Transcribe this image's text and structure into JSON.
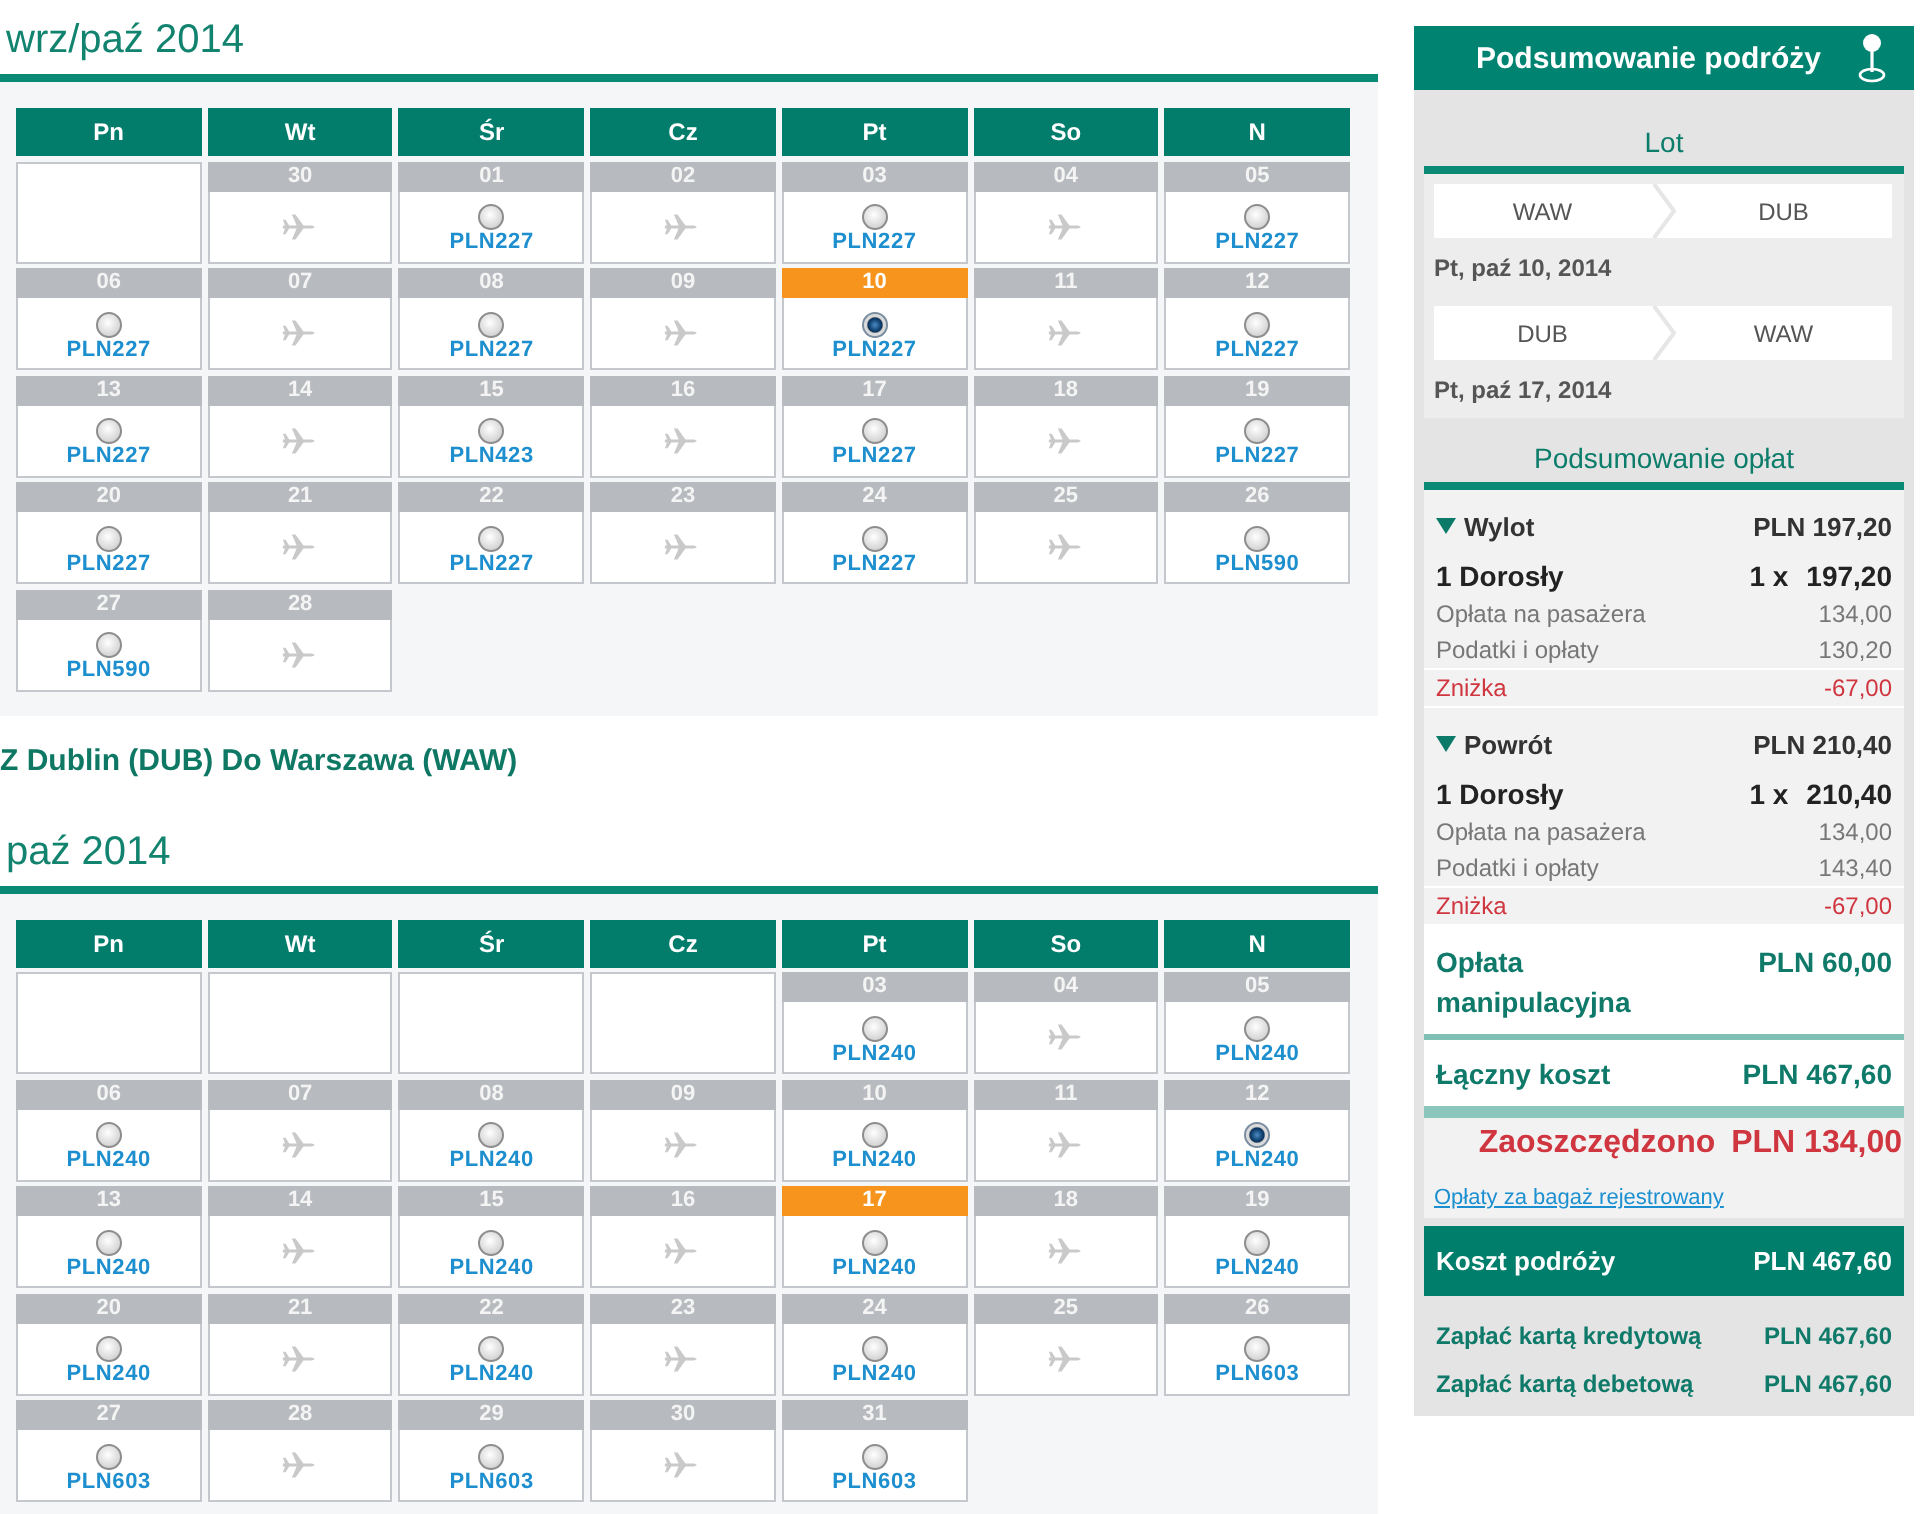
{
  "outbound": {
    "title": "wrz/paź 2014",
    "weekdays": [
      "Pn",
      "Wt",
      "Śr",
      "Cz",
      "Pt",
      "So",
      "N"
    ],
    "weeks": [
      [
        {
          "kind": "empty"
        },
        {
          "kind": "unavailable",
          "day": "30",
          "highlighted": false
        },
        {
          "kind": "fare",
          "day": "01",
          "highlighted": false,
          "selected": false,
          "price": "PLN227"
        },
        {
          "kind": "unavailable",
          "day": "02",
          "highlighted": false
        },
        {
          "kind": "fare",
          "day": "03",
          "highlighted": false,
          "selected": false,
          "price": "PLN227"
        },
        {
          "kind": "unavailable",
          "day": "04",
          "highlighted": false
        },
        {
          "kind": "fare",
          "day": "05",
          "highlighted": false,
          "selected": false,
          "price": "PLN227"
        }
      ],
      [
        {
          "kind": "fare",
          "day": "06",
          "highlighted": false,
          "selected": false,
          "price": "PLN227"
        },
        {
          "kind": "unavailable",
          "day": "07",
          "highlighted": false
        },
        {
          "kind": "fare",
          "day": "08",
          "highlighted": false,
          "selected": false,
          "price": "PLN227"
        },
        {
          "kind": "unavailable",
          "day": "09",
          "highlighted": false
        },
        {
          "kind": "fare",
          "day": "10",
          "highlighted": true,
          "selected": true,
          "price": "PLN227"
        },
        {
          "kind": "unavailable",
          "day": "11",
          "highlighted": false
        },
        {
          "kind": "fare",
          "day": "12",
          "highlighted": false,
          "selected": false,
          "price": "PLN227"
        }
      ],
      [
        {
          "kind": "fare",
          "day": "13",
          "highlighted": false,
          "selected": false,
          "price": "PLN227"
        },
        {
          "kind": "unavailable",
          "day": "14",
          "highlighted": false
        },
        {
          "kind": "fare",
          "day": "15",
          "highlighted": false,
          "selected": false,
          "price": "PLN423"
        },
        {
          "kind": "unavailable",
          "day": "16",
          "highlighted": false
        },
        {
          "kind": "fare",
          "day": "17",
          "highlighted": false,
          "selected": false,
          "price": "PLN227"
        },
        {
          "kind": "unavailable",
          "day": "18",
          "highlighted": false
        },
        {
          "kind": "fare",
          "day": "19",
          "highlighted": false,
          "selected": false,
          "price": "PLN227"
        }
      ],
      [
        {
          "kind": "fare",
          "day": "20",
          "highlighted": false,
          "selected": false,
          "price": "PLN227"
        },
        {
          "kind": "unavailable",
          "day": "21",
          "highlighted": false
        },
        {
          "kind": "fare",
          "day": "22",
          "highlighted": false,
          "selected": false,
          "price": "PLN227"
        },
        {
          "kind": "unavailable",
          "day": "23",
          "highlighted": false
        },
        {
          "kind": "fare",
          "day": "24",
          "highlighted": false,
          "selected": false,
          "price": "PLN227"
        },
        {
          "kind": "unavailable",
          "day": "25",
          "highlighted": false
        },
        {
          "kind": "fare",
          "day": "26",
          "highlighted": false,
          "selected": false,
          "price": "PLN590"
        }
      ],
      [
        {
          "kind": "fare",
          "day": "27",
          "highlighted": false,
          "selected": false,
          "price": "PLN590"
        },
        {
          "kind": "unavailable",
          "day": "28",
          "highlighted": false
        }
      ]
    ]
  },
  "return_route": "Z Dublin (DUB) Do Warszawa (WAW)",
  "return": {
    "title": "paź 2014",
    "weekdays": [
      "Pn",
      "Wt",
      "Śr",
      "Cz",
      "Pt",
      "So",
      "N"
    ],
    "weeks": [
      [
        {
          "kind": "empty"
        },
        {
          "kind": "empty"
        },
        {
          "kind": "empty"
        },
        {
          "kind": "empty"
        },
        {
          "kind": "fare",
          "day": "03",
          "highlighted": false,
          "selected": false,
          "price": "PLN240"
        },
        {
          "kind": "unavailable",
          "day": "04",
          "highlighted": false
        },
        {
          "kind": "fare",
          "day": "05",
          "highlighted": false,
          "selected": false,
          "price": "PLN240"
        }
      ],
      [
        {
          "kind": "fare",
          "day": "06",
          "highlighted": false,
          "selected": false,
          "price": "PLN240"
        },
        {
          "kind": "unavailable",
          "day": "07",
          "highlighted": false
        },
        {
          "kind": "fare",
          "day": "08",
          "highlighted": false,
          "selected": false,
          "price": "PLN240"
        },
        {
          "kind": "unavailable",
          "day": "09",
          "highlighted": false
        },
        {
          "kind": "fare",
          "day": "10",
          "highlighted": false,
          "selected": false,
          "price": "PLN240"
        },
        {
          "kind": "unavailable",
          "day": "11",
          "highlighted": false
        },
        {
          "kind": "fare",
          "day": "12",
          "highlighted": false,
          "selected": true,
          "price": "PLN240"
        }
      ],
      [
        {
          "kind": "fare",
          "day": "13",
          "highlighted": false,
          "selected": false,
          "price": "PLN240"
        },
        {
          "kind": "unavailable",
          "day": "14",
          "highlighted": false
        },
        {
          "kind": "fare",
          "day": "15",
          "highlighted": false,
          "selected": false,
          "price": "PLN240"
        },
        {
          "kind": "unavailable",
          "day": "16",
          "highlighted": false
        },
        {
          "kind": "fare",
          "day": "17",
          "highlighted": true,
          "selected": false,
          "price": "PLN240"
        },
        {
          "kind": "unavailable",
          "day": "18",
          "highlighted": false
        },
        {
          "kind": "fare",
          "day": "19",
          "highlighted": false,
          "selected": false,
          "price": "PLN240"
        }
      ],
      [
        {
          "kind": "fare",
          "day": "20",
          "highlighted": false,
          "selected": false,
          "price": "PLN240"
        },
        {
          "kind": "unavailable",
          "day": "21",
          "highlighted": false
        },
        {
          "kind": "fare",
          "day": "22",
          "highlighted": false,
          "selected": false,
          "price": "PLN240"
        },
        {
          "kind": "unavailable",
          "day": "23",
          "highlighted": false
        },
        {
          "kind": "fare",
          "day": "24",
          "highlighted": false,
          "selected": false,
          "price": "PLN240"
        },
        {
          "kind": "unavailable",
          "day": "25",
          "highlighted": false
        },
        {
          "kind": "fare",
          "day": "26",
          "highlighted": false,
          "selected": false,
          "price": "PLN603"
        }
      ],
      [
        {
          "kind": "fare",
          "day": "27",
          "highlighted": false,
          "selected": false,
          "price": "PLN603"
        },
        {
          "kind": "unavailable",
          "day": "28",
          "highlighted": false
        },
        {
          "kind": "fare",
          "day": "29",
          "highlighted": false,
          "selected": false,
          "price": "PLN603"
        },
        {
          "kind": "unavailable",
          "day": "30",
          "highlighted": false
        },
        {
          "kind": "fare",
          "day": "31",
          "highlighted": false,
          "selected": false,
          "price": "PLN603"
        }
      ]
    ]
  },
  "summary": {
    "title": "Podsumowanie podróży",
    "flight_heading": "Lot",
    "legs": [
      {
        "from": "WAW",
        "to": "DUB",
        "date": "Pt, paź 10, 2014"
      },
      {
        "from": "DUB",
        "to": "WAW",
        "date": "Pt, paź 17, 2014"
      }
    ],
    "fees_heading": "Podsumowanie opłat",
    "segments": [
      {
        "label": "Wylot",
        "total": "PLN 197,20",
        "expanded": true,
        "passengers": "1 Dorosły",
        "quantity": "1 x",
        "price": "197,20",
        "lines": [
          {
            "kind": "charge",
            "label": "Opłata na pasażera",
            "amount": "134,00"
          },
          {
            "kind": "charge",
            "label": "Podatki i opłaty",
            "amount": "130,20"
          },
          {
            "kind": "discount",
            "label": "Zniżka",
            "amount": "-67,00"
          }
        ]
      },
      {
        "label": "Powrót",
        "total": "PLN 210,40",
        "expanded": true,
        "passengers": "1 Dorosły",
        "quantity": "1 x",
        "price": "210,40",
        "lines": [
          {
            "kind": "charge",
            "label": "Opłata na pasażera",
            "amount": "134,00"
          },
          {
            "kind": "charge",
            "label": "Podatki i opłaty",
            "amount": "143,40"
          },
          {
            "kind": "discount",
            "label": "Zniżka",
            "amount": "-67,00"
          }
        ]
      }
    ],
    "handling_fee": {
      "label": "Opłata manipulacyjna",
      "amount": "PLN 60,00"
    },
    "total": {
      "label": "Łączny koszt",
      "amount": "PLN 467,60"
    },
    "savings": {
      "label": "Zaoszczędzono",
      "amount": "PLN 134,00"
    },
    "baggage_link": "Opłaty za bagaż rejestrowany",
    "trip_cost": {
      "label": "Koszt podróży",
      "amount": "PLN 467,60"
    },
    "payments": [
      {
        "label": "Zapłać kartą kredytową",
        "amount": "PLN 467,60"
      },
      {
        "label": "Zapłać kartą debetową",
        "amount": "PLN 467,60"
      }
    ]
  }
}
